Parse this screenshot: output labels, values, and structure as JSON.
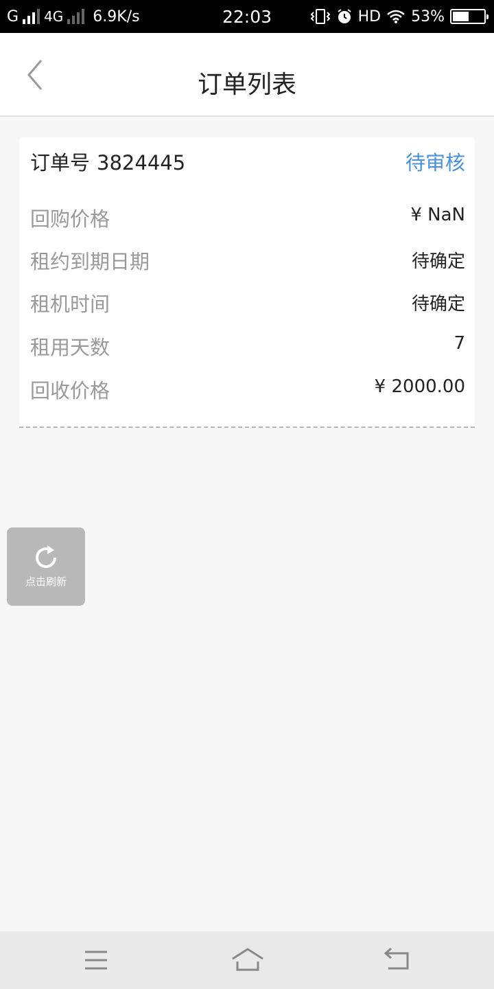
{
  "status_bar": {
    "carrier1": "G",
    "carrier2": "4G",
    "speed": "6.9K/s",
    "time": "22:03",
    "hd": "HD",
    "battery": "53%",
    "battery_level": 0.53
  },
  "header": {
    "title": "订单列表"
  },
  "order": {
    "number_label": "订单号",
    "number": "3824445",
    "status": "待审核",
    "rows": [
      {
        "label": "回购价格",
        "value": "¥ NaN"
      },
      {
        "label": "租约到期日期",
        "value": "待确定"
      },
      {
        "label": "租机时间",
        "value": "待确定"
      },
      {
        "label": "租用天数",
        "value": "7"
      },
      {
        "label": "回收价格",
        "value": "¥ 2000.00"
      }
    ]
  },
  "refresh": {
    "label": "点击刷新"
  },
  "colors": {
    "accent": "#4a90d9",
    "background": "#f7f7f7",
    "label_gray": "#999999"
  }
}
